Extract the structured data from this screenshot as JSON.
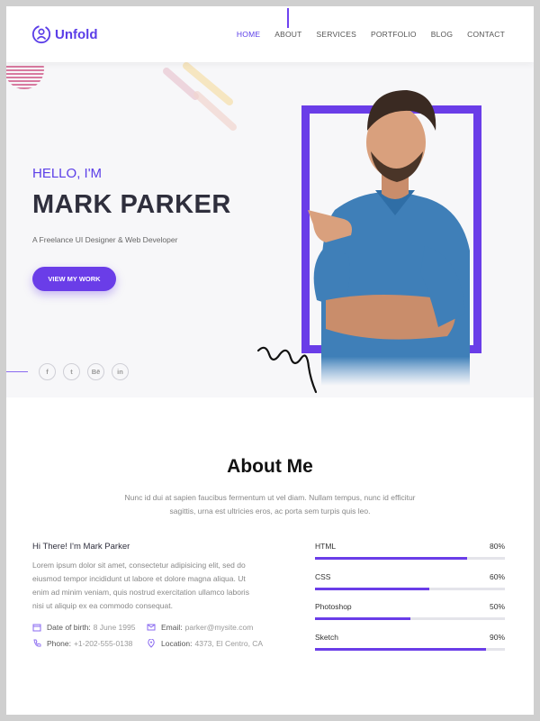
{
  "brand": {
    "name": "Unfold",
    "accent": "#6a3de8"
  },
  "nav": {
    "items": [
      {
        "label": "HOME",
        "active": true
      },
      {
        "label": "ABOUT",
        "active": false
      },
      {
        "label": "SERVICES",
        "active": false
      },
      {
        "label": "PORTFOLIO",
        "active": false
      },
      {
        "label": "BLOG",
        "active": false
      },
      {
        "label": "CONTACT",
        "active": false
      }
    ]
  },
  "hero": {
    "greeting": "HELLO, I'M",
    "name": "MARK PARKER",
    "tagline": "A Freelance UI Designer & Web Developer",
    "cta_label": "VIEW MY WORK",
    "socials": [
      {
        "icon": "facebook-icon",
        "glyph": "f"
      },
      {
        "icon": "twitter-icon",
        "glyph": "t"
      },
      {
        "icon": "behance-icon",
        "glyph": "Bē"
      },
      {
        "icon": "linkedin-icon",
        "glyph": "in"
      }
    ]
  },
  "about": {
    "title": "About Me",
    "intro": "Nunc id dui at sapien faucibus fermentum ut vel diam. Nullam tempus, nunc id efficitur sagittis, urna est ultricies eros, ac porta sem turpis quis leo.",
    "bio_heading": "Hi There! I'm Mark Parker",
    "bio_text": "Lorem ipsum dolor sit amet, consectetur adipisicing elit, sed do eiusmod tempor incididunt ut labore et dolore magna aliqua. Ut enim ad minim veniam, quis nostrud exercitation ullamco laboris nisi ut aliquip ex ea commodo consequat.",
    "info": {
      "dob_label": "Date of birth:",
      "dob_value": "8 June 1995",
      "email_label": "Email:",
      "email_value": "parker@mysite.com",
      "phone_label": "Phone:",
      "phone_value": "+1-202-555-0138",
      "location_label": "Location:",
      "location_value": "4373, El Centro, CA"
    },
    "skills": [
      {
        "name": "HTML",
        "percent_label": "80%",
        "level": 0.8
      },
      {
        "name": "CSS",
        "percent_label": "60%",
        "level": 0.6
      },
      {
        "name": "Photoshop",
        "percent_label": "50%",
        "level": 0.5
      },
      {
        "name": "Sketch",
        "percent_label": "90%",
        "level": 0.9
      }
    ]
  }
}
